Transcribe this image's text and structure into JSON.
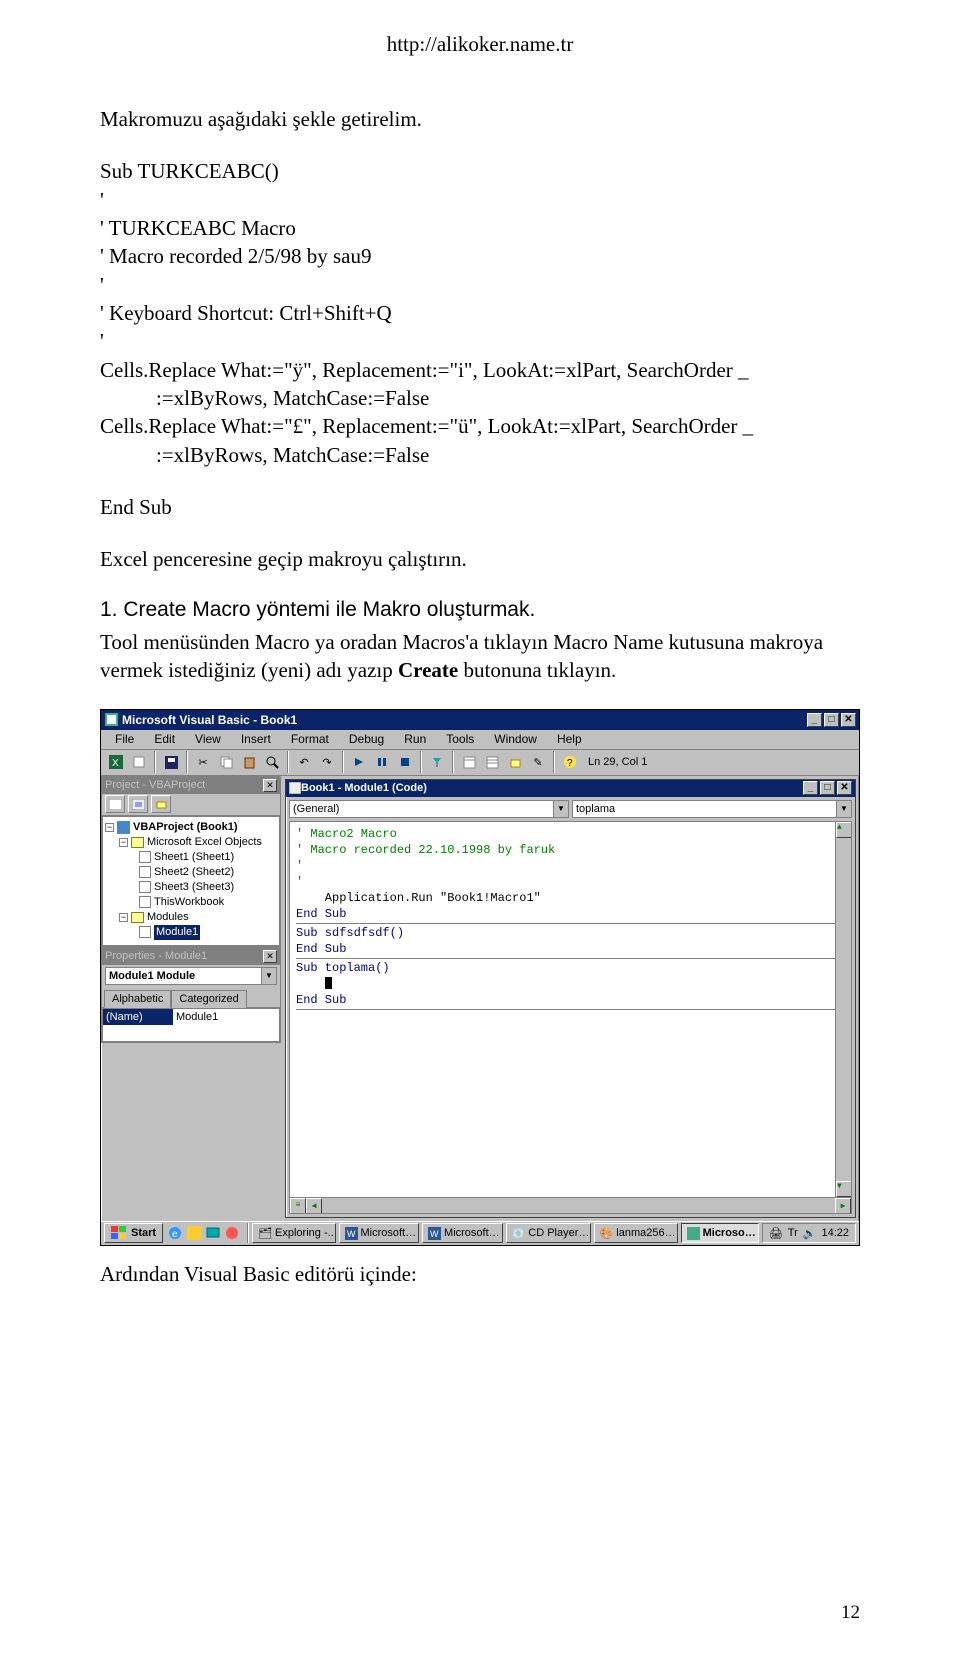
{
  "header_url": "http://alikoker.name.tr",
  "para1": "Makromuzu aşağıdaki şekle getirelim.",
  "code": {
    "l1": "Sub TURKCEABC()",
    "l2": "'",
    "l3": "' TURKCEABC Macro",
    "l4": "' Macro recorded 2/5/98 by sau9",
    "l5": "'",
    "l6": "' Keyboard Shortcut: Ctrl+Shift+Q",
    "l7": "'",
    "l8": "Cells.Replace What:=\"ÿ\", Replacement:=\"i\", LookAt:=xlPart, SearchOrder _",
    "l8b": ":=xlByRows, MatchCase:=False",
    "l9": "Cells.Replace What:=\"£\", Replacement:=\"ü\", LookAt:=xlPart, SearchOrder _",
    "l9b": ":=xlByRows, MatchCase:=False",
    "l10": "End Sub"
  },
  "para2": "Excel penceresine geçip makroyu çalıştırın.",
  "heading": "1. Create Macro yöntemi ile  Makro oluşturmak.",
  "para3a": "Tool menüsünden Macro ya oradan Macros'a tıklayın Macro Name kutusuna makroya vermek istediğiniz (yeni) adı yazıp ",
  "para3b": "Create",
  "para3c": " butonuna tıklayın.",
  "para4": "Ardından Visual Basic editörü içinde:",
  "page_num": "12",
  "vb": {
    "title": "Microsoft Visual Basic - Book1",
    "menu": [
      "File",
      "Edit",
      "View",
      "Insert",
      "Format",
      "Debug",
      "Run",
      "Tools",
      "Window",
      "Help"
    ],
    "lncol": "Ln 29, Col 1",
    "project_panel_title": "Project - VBAProject",
    "tree": {
      "root": "VBAProject (Book1)",
      "excel_objects": "Microsoft Excel Objects",
      "sheets": [
        "Sheet1 (Sheet1)",
        "Sheet2 (Sheet2)",
        "Sheet3 (Sheet3)",
        "ThisWorkbook"
      ],
      "modules_folder": "Modules",
      "module": "Module1"
    },
    "props_panel_title": "Properties - Module1",
    "props_combo_text": "Module1 Module",
    "props_tabs": [
      "Alphabetic",
      "Categorized"
    ],
    "prop_name_key": "(Name)",
    "prop_name_val": "Module1",
    "code_title": "Book1 - Module1 (Code)",
    "combo_left": "(General)",
    "combo_right": "toplama",
    "code_lines": [
      "' Macro2 Macro",
      "' Macro recorded 22.10.1998 by faruk",
      "'",
      "",
      "'",
      "    Application.Run \"Book1!Macro1\"",
      "End Sub",
      "Sub sdfsdfsdf()",
      "",
      "End Sub",
      "Sub toplama()",
      "",
      "",
      "",
      "",
      "",
      "",
      "",
      "End Sub"
    ]
  },
  "taskbar": {
    "start": "Start",
    "items": [
      "Exploring -..",
      "Microsoft…",
      "Microsoft…",
      "CD Player…",
      "lanma256…",
      "Microso…"
    ],
    "tray_lang": "Tr",
    "clock": "14:22"
  }
}
